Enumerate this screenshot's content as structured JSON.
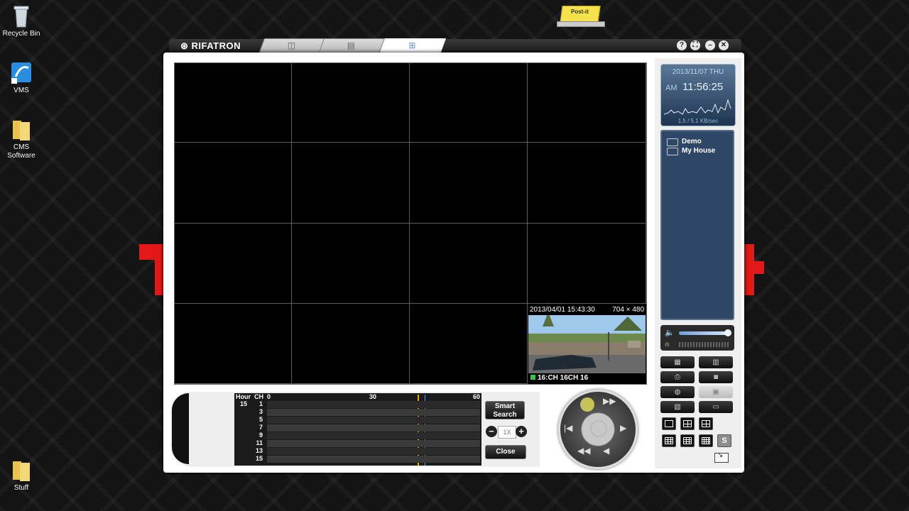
{
  "desktop": {
    "icons": [
      {
        "label": "Recycle Bin"
      },
      {
        "label": "VMS"
      },
      {
        "label": "CMS Software"
      },
      {
        "label": "Stuff"
      }
    ],
    "postit_label": "Post-it"
  },
  "window": {
    "brand": "RIFATRON",
    "tabs": [
      {
        "icon": "camera-icon"
      },
      {
        "icon": "dvr-icon"
      },
      {
        "icon": "search-playback-icon"
      }
    ],
    "title_buttons": [
      "?",
      "⛶",
      "–",
      "✕"
    ]
  },
  "video": {
    "timestamp": "2013/04/01 15:43:30",
    "resolution": "704 × 480",
    "channel_label": "16:CH 16CH 16"
  },
  "timeline": {
    "header_hour": "Hour",
    "header_ch": "CH",
    "hour_value": "15",
    "ticks": [
      "0",
      "30",
      "60"
    ],
    "channels": [
      "1",
      "3",
      "5",
      "7",
      "9",
      "11",
      "13",
      "15"
    ]
  },
  "controls": {
    "smart_search": "Smart Search",
    "speed": "1X",
    "minus": "−",
    "plus": "+",
    "close": "Close"
  },
  "clock": {
    "date": "2013/11/07 THU",
    "ampm": "AM",
    "time": "11:56:25",
    "rate": "1.5 / 5.1 KB/sec"
  },
  "sites": [
    "Demo",
    "My House"
  ],
  "layout_buttons": {
    "s_label": "S"
  }
}
